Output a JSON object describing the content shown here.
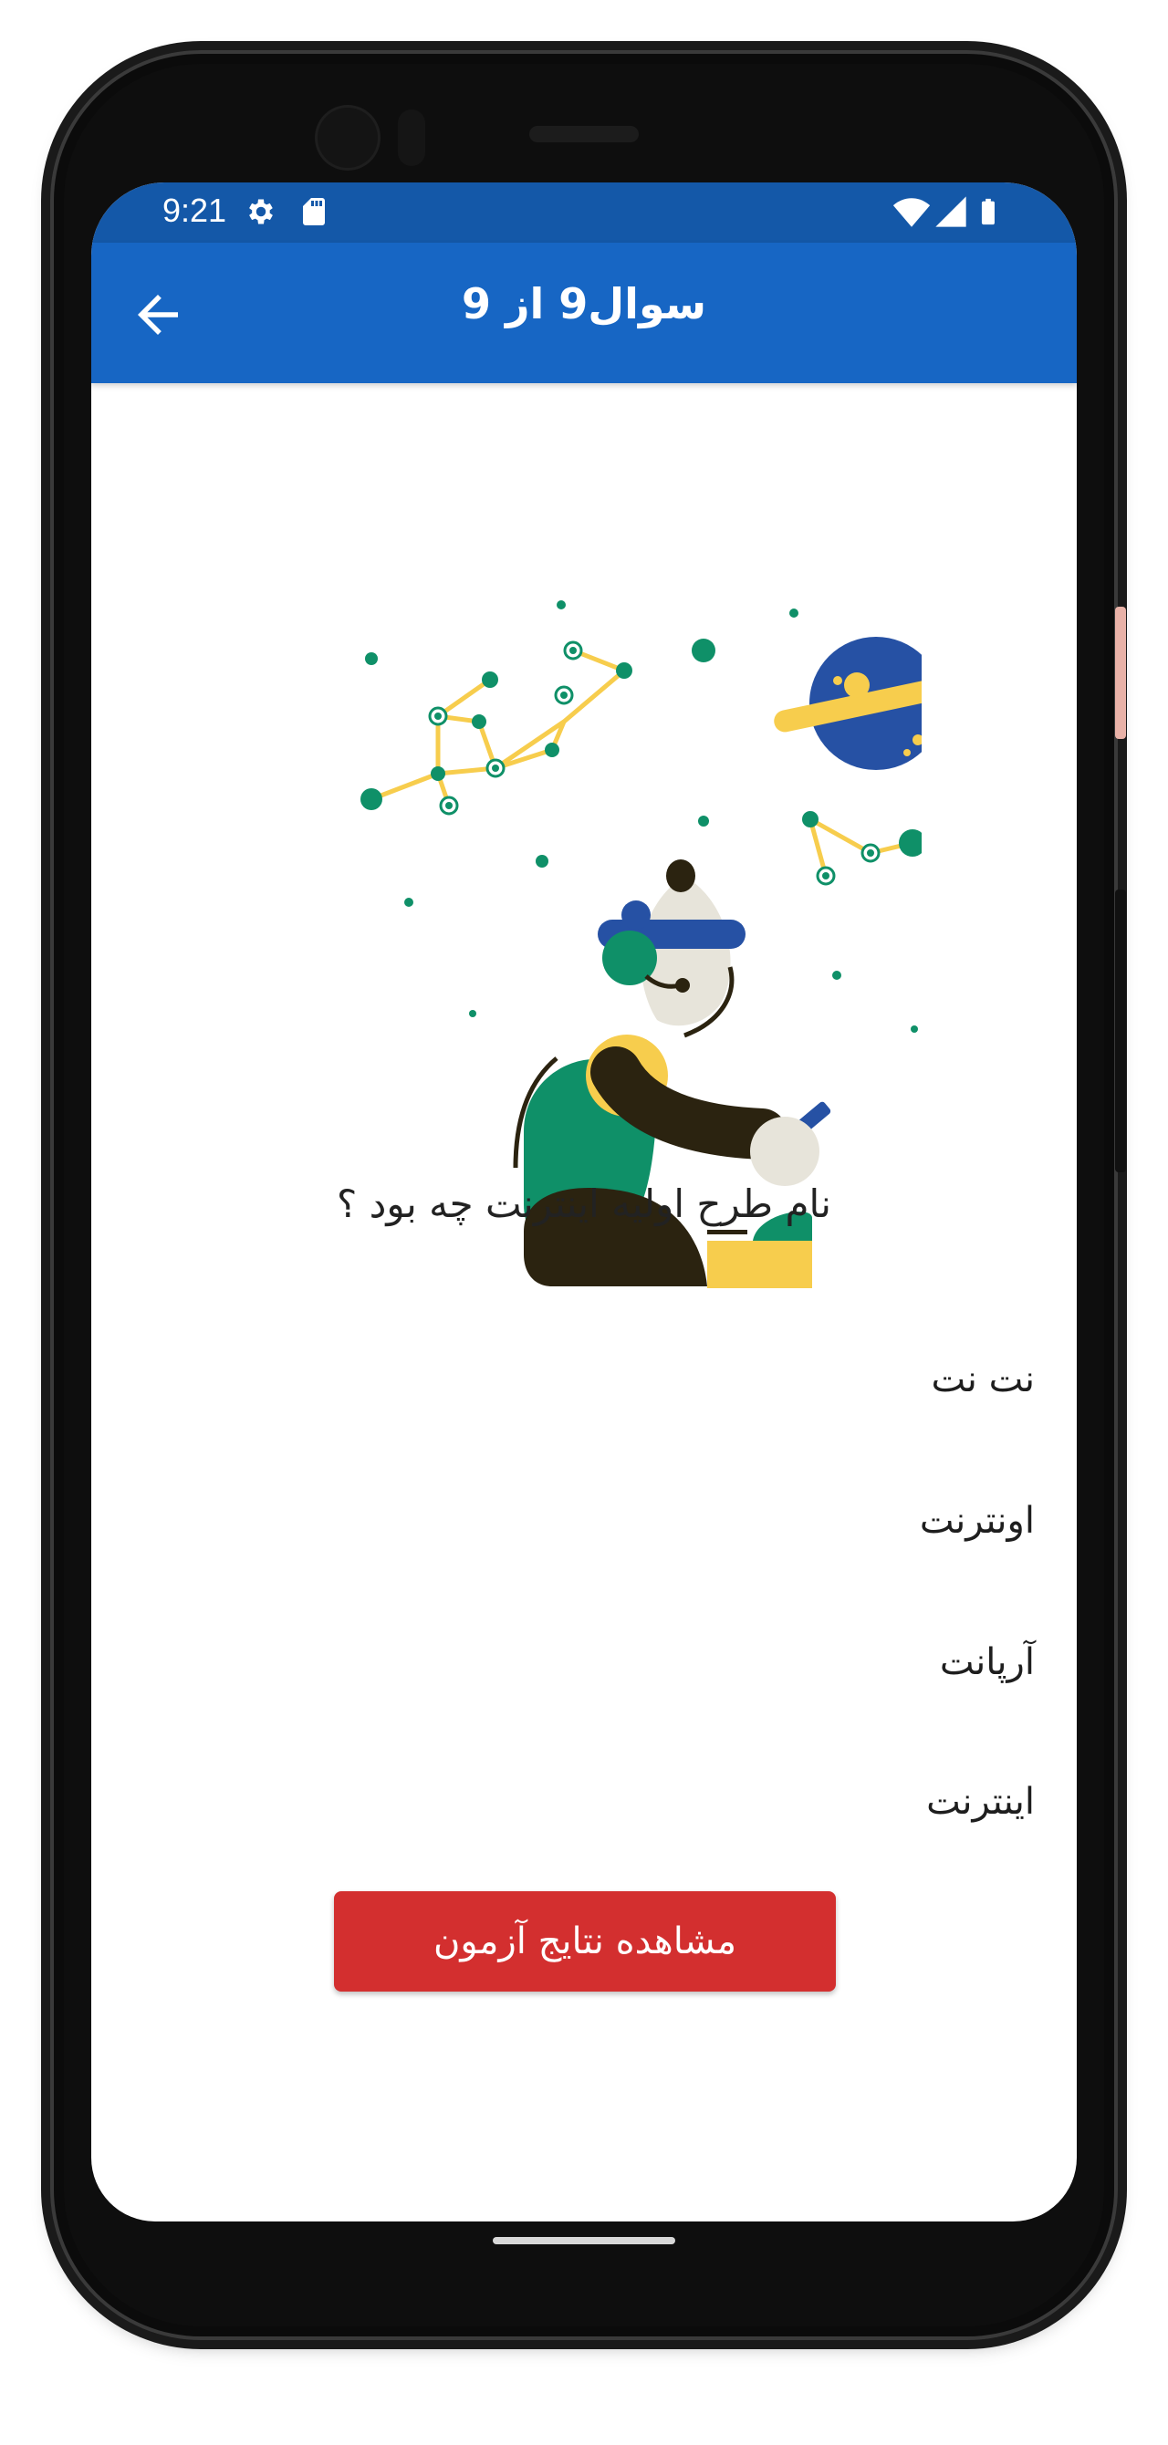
{
  "status_bar": {
    "time": "9:21",
    "icons": [
      "settings-icon",
      "sd-card-icon",
      "wifi-icon",
      "signal-icon",
      "battery-icon"
    ]
  },
  "app_bar": {
    "title": "سوال9 از 9",
    "back_icon": "arrow-back-icon"
  },
  "quiz": {
    "question": "نام طرح اولیه اینترنت چه بود ؟",
    "answers": [
      "نت نت",
      "اونترنت",
      "آرپانت",
      "اینترنت"
    ],
    "results_button": "مشاهده نتایج آزمون"
  },
  "colors": {
    "status_bar": "#1458a8",
    "app_bar": "#1766c4",
    "button": "#d32f2f",
    "teal": "#0f9068",
    "yellow": "#f7cd4d",
    "navy": "#2651a4",
    "dark": "#2b2310"
  }
}
